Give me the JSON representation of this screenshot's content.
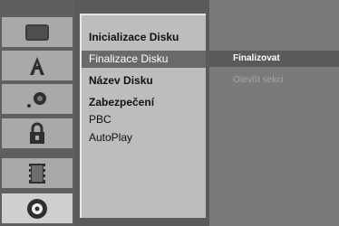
{
  "sidebar": {
    "icons": [
      {
        "name": "display-setup-icon",
        "active": false
      },
      {
        "name": "language-icon",
        "active": false
      },
      {
        "name": "audio-icon",
        "active": false
      },
      {
        "name": "lock-icon",
        "active": false
      },
      {
        "name": "recording-icon",
        "active": false
      },
      {
        "name": "disc-icon",
        "active": true
      }
    ]
  },
  "menu": {
    "items": [
      {
        "label": "Inicializace Disku",
        "bold": true,
        "selected": false
      },
      {
        "label": "Finalizace Disku",
        "bold": false,
        "selected": true
      },
      {
        "label": "Název Disku",
        "bold": true,
        "selected": false
      },
      {
        "label": "Zabezpečení",
        "bold": true,
        "selected": false
      },
      {
        "label": "PBC",
        "bold": false,
        "selected": false
      },
      {
        "label": "AutoPlay",
        "bold": false,
        "selected": false
      }
    ]
  },
  "submenu": {
    "items": [
      {
        "label": "Finalizovat",
        "selected": true,
        "enabled": true
      },
      {
        "label": "Otevřít sekci",
        "selected": false,
        "enabled": false
      }
    ]
  },
  "colors": {
    "sidebar_bg": "#5f5f5f",
    "icon_tile": "#a9a9a9",
    "icon_tile_active": "#cfcfcf",
    "menu_box": "#bdbdbd",
    "highlight": "#6a6a6a",
    "submenu_bg": "#7a7a7a",
    "submenu_disabled_text": "#a4a4a4"
  }
}
